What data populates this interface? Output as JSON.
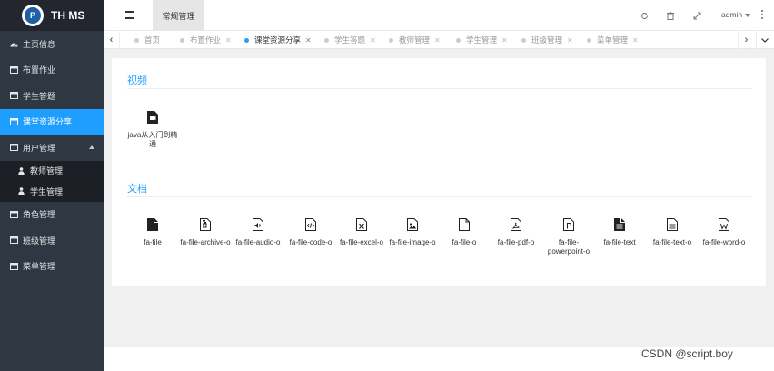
{
  "app": {
    "title": "TH MS",
    "logo_letter": "P"
  },
  "sidebar": {
    "items": [
      {
        "label": "主页信息",
        "icon": "dashboard-icon"
      },
      {
        "label": "布置作业",
        "icon": "window-icon"
      },
      {
        "label": "学生答题",
        "icon": "window-icon"
      },
      {
        "label": "课堂资源分享",
        "icon": "window-icon",
        "active": true
      },
      {
        "label": "用户管理",
        "icon": "window-icon",
        "expanded": true
      }
    ],
    "sub_items": [
      {
        "label": "教师管理",
        "icon": "user-icon"
      },
      {
        "label": "学生管理",
        "icon": "user-icon"
      }
    ],
    "items_after": [
      {
        "label": "角色管理",
        "icon": "window-icon"
      },
      {
        "label": "班级管理",
        "icon": "window-icon"
      },
      {
        "label": "菜单管理",
        "icon": "window-icon"
      }
    ]
  },
  "topbar": {
    "active_tab": "常规管理",
    "user": "admin"
  },
  "tabs": [
    {
      "label": "首页"
    },
    {
      "label": "布置作业"
    },
    {
      "label": "课堂资源分享",
      "active": true
    },
    {
      "label": "学生答题"
    },
    {
      "label": "教师管理"
    },
    {
      "label": "学生管理"
    },
    {
      "label": "班级管理"
    },
    {
      "label": "菜单管理"
    }
  ],
  "content": {
    "video_section": {
      "title": "视频",
      "items": [
        {
          "label": "java从入门到精通",
          "icon": "video-file-icon"
        }
      ]
    },
    "doc_section": {
      "title": "文档",
      "items": [
        {
          "label": "fa-file",
          "icon": "file-solid-icon"
        },
        {
          "label": "fa-file-archive-o",
          "icon": "file-archive-icon"
        },
        {
          "label": "fa-file-audio-o",
          "icon": "file-audio-icon"
        },
        {
          "label": "fa-file-code-o",
          "icon": "file-code-icon"
        },
        {
          "label": "fa-file-excel-o",
          "icon": "file-excel-icon"
        },
        {
          "label": "fa-file-image-o",
          "icon": "file-image-icon"
        },
        {
          "label": "fa-file-o",
          "icon": "file-outline-icon"
        },
        {
          "label": "fa-file-pdf-o",
          "icon": "file-pdf-icon"
        },
        {
          "label": "fa-file-powerpoint-o",
          "icon": "file-powerpoint-icon"
        },
        {
          "label": "fa-file-text",
          "icon": "file-text-solid-icon"
        },
        {
          "label": "fa-file-text-o",
          "icon": "file-text-icon"
        },
        {
          "label": "fa-file-word-o",
          "icon": "file-word-icon"
        }
      ]
    }
  },
  "watermark": "CSDN @script.boy"
}
